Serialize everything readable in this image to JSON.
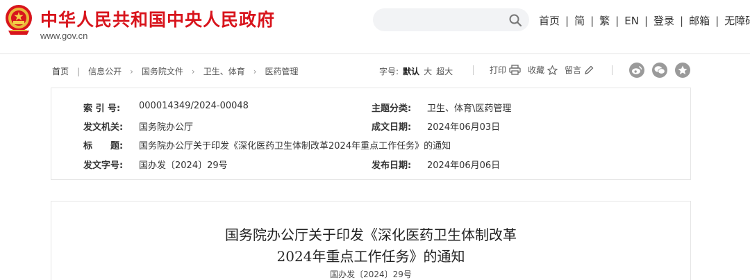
{
  "header": {
    "site_title": "中华人民共和国中央人民政府",
    "domain": "www.gov.cn",
    "search": {
      "placeholder": ""
    },
    "nav": [
      "首页",
      "简",
      "繁",
      "EN",
      "登录",
      "邮箱",
      "无障碍"
    ],
    "brand_color": "#d8141c"
  },
  "breadcrumb": [
    "首页",
    "信息公开",
    "国务院文件",
    "卫生、体育",
    "医药管理"
  ],
  "font_size": {
    "label": "字号:",
    "options": [
      "默认",
      "大",
      "超大"
    ],
    "selected": "默认"
  },
  "tools": {
    "print": "打印",
    "favorite": "收藏",
    "comment": "留言"
  },
  "share_icons": [
    "weibo-icon",
    "wechat-icon",
    "qzone-icon"
  ],
  "metadata": {
    "index": {
      "label": "索 引 号:",
      "value": "000014349/2024-00048"
    },
    "category": {
      "label": "主题分类:",
      "value": "卫生、体育\\医药管理"
    },
    "issuer": {
      "label": "发文机关:",
      "value": "国务院办公厅"
    },
    "created": {
      "label": "成文日期:",
      "value": "2024年06月03日"
    },
    "title": {
      "label": "标　　题:",
      "value": "国务院办公厅关于印发《深化医药卫生体制改革2024年重点工作任务》的通知"
    },
    "doc_number": {
      "label": "发文字号:",
      "value": "国办发〔2024〕29号"
    },
    "published": {
      "label": "发布日期:",
      "value": "2024年06月06日"
    }
  },
  "article": {
    "title_line1": "国务院办公厅关于印发《深化医药卫生体制改革",
    "title_line2": "2024年重点工作任务》的通知",
    "doc_number": "国办发〔2024〕29号"
  }
}
